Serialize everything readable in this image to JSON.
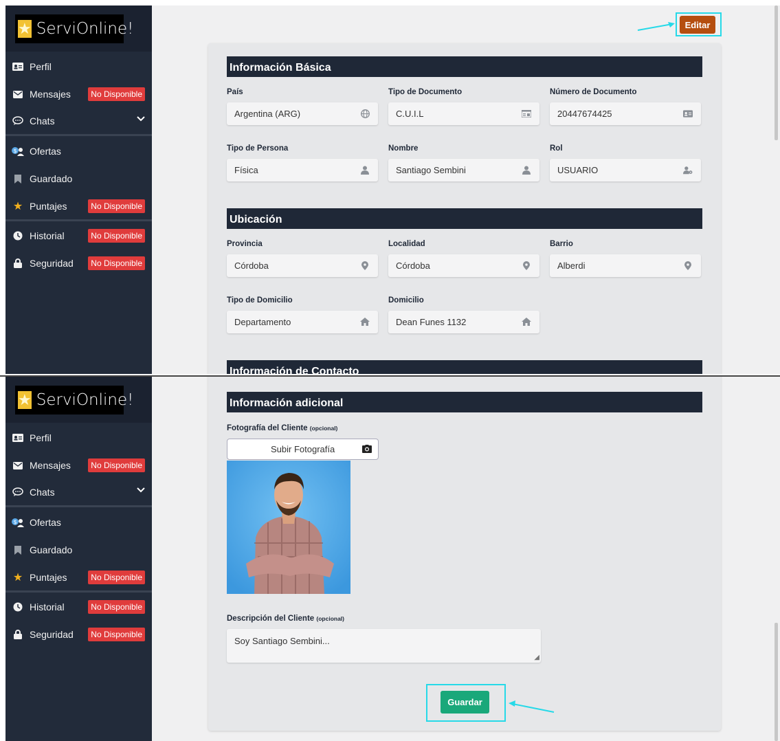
{
  "app": {
    "title": "ServiOnline!"
  },
  "sidebar": {
    "items": [
      {
        "label": "Perfil",
        "icon": "id-card-icon"
      },
      {
        "label": "Mensajes",
        "icon": "envelope-icon",
        "badge": "No Disponible"
      },
      {
        "label": "Chats",
        "icon": "chat-bubble-icon",
        "chevron": "chevron-down-icon"
      },
      {
        "label": "Ofertas",
        "icon": "money-user-icon"
      },
      {
        "label": "Guardado",
        "icon": "bookmark-icon"
      },
      {
        "label": "Puntajes",
        "icon": "star-icon",
        "badge": "No Disponible"
      },
      {
        "label": "Historial",
        "icon": "clock-icon",
        "badge": "No Disponible"
      },
      {
        "label": "Seguridad",
        "icon": "lock-icon",
        "badge": "No Disponible"
      }
    ]
  },
  "toolbar": {
    "edit_label": "Editar",
    "save_label": "Guardar"
  },
  "sections": {
    "basic": {
      "title": "Información Básica",
      "fields": [
        {
          "label": "País",
          "value": "Argentina (ARG)",
          "icon": "globe-icon"
        },
        {
          "label": "Tipo de Documento",
          "value": "C.U.I.L",
          "icon": "id-card-icon"
        },
        {
          "label": "Número de Documento",
          "value": "20447674425",
          "icon": "id-card-icon"
        },
        {
          "label": "Tipo de Persona",
          "value": "Física",
          "icon": "user-icon"
        },
        {
          "label": "Nombre",
          "value": "Santiago Sembini",
          "icon": "user-icon"
        },
        {
          "label": "Rol",
          "value": "USUARIO",
          "icon": "user-gear-icon"
        }
      ]
    },
    "location": {
      "title": "Ubicación",
      "fields": [
        {
          "label": "Provincia",
          "value": "Córdoba",
          "icon": "map-pin-icon"
        },
        {
          "label": "Localidad",
          "value": "Córdoba",
          "icon": "map-pin-icon"
        },
        {
          "label": "Barrio",
          "value": "Alberdi",
          "icon": "map-pin-icon"
        },
        {
          "label": "Tipo de Domicilio",
          "value": "Departamento",
          "icon": "home-icon"
        },
        {
          "label": "Domicilio",
          "value": "Dean Funes 1132",
          "icon": "home-icon"
        }
      ]
    },
    "contact": {
      "title": "Información de Contacto"
    },
    "additional": {
      "title": "Información adicional",
      "photo_label": "Fotografía del Cliente",
      "photo_optional": "(opcional)",
      "upload_label": "Subir Fotografía",
      "description_label": "Descripción del Cliente",
      "description_optional": "(opcional)",
      "description_value": "Soy Santiago Sembini..."
    }
  },
  "colors": {
    "accent_edit": "#b54e0f",
    "accent_save": "#1aa87a",
    "badge": "#e03c3c",
    "highlight": "#26d9e8",
    "sidebar": "#222b3a"
  }
}
